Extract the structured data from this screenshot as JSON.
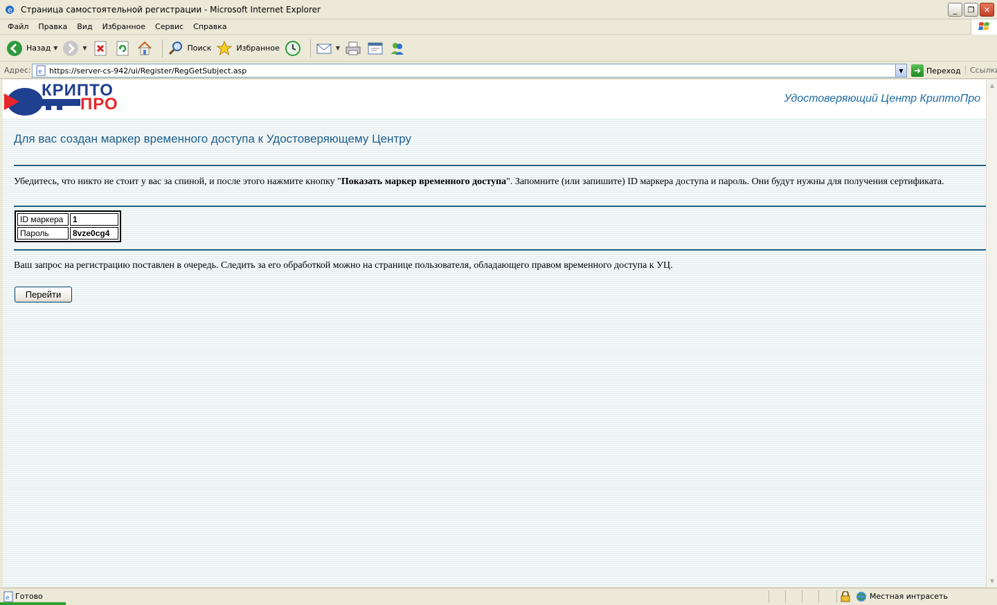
{
  "window": {
    "title": "Страница самостоятельной регистрации - Microsoft Internet Explorer",
    "minimize_glyph": "_",
    "restore_glyph": "❐",
    "close_glyph": "✕"
  },
  "menubar": {
    "items": [
      "Файл",
      "Правка",
      "Вид",
      "Избранное",
      "Сервис",
      "Справка"
    ]
  },
  "toolbar": {
    "back_label": "Назад",
    "search_label": "Поиск",
    "favorites_label": "Избранное"
  },
  "addressbar": {
    "label": "Адрес:",
    "url": "https://server-cs-942/ui/Register/RegGetSubject.asp",
    "go_label": "Переход",
    "links_label": "Ссылки"
  },
  "page": {
    "logo": {
      "line1": "КРИПТО",
      "line2": "ПРО"
    },
    "center_name": "Удостоверяющий Центр КриптоПро",
    "heading": "Для вас создан маркер временного доступа к Удостоверяющему Центру",
    "instruction_before": "Убедитесь, что никто не стоит у вас за спиной, и после этого нажмите кнопку \"",
    "instruction_bold": "Показать маркер временного доступа",
    "instruction_after": "\". Запомните (или запишите) ID маркера доступа и пароль. Они будут нужны для получения сертификата.",
    "token": {
      "id_label": "ID маркера",
      "id_value": "1",
      "password_label": "Пароль",
      "password_value": "8vze0cg4"
    },
    "queue_text": "Ваш запрос на регистрацию поставлен в очередь. Следить за его обработкой можно на странице пользователя, обладающего правом временного доступа к УЦ.",
    "go_button": "Перейти"
  },
  "statusbar": {
    "status": "Готово",
    "zone": "Местная интрасеть"
  },
  "colors": {
    "accent": "#1f5f8f",
    "logo_blue": "#1f3f8f",
    "logo_red": "#e8262a"
  }
}
